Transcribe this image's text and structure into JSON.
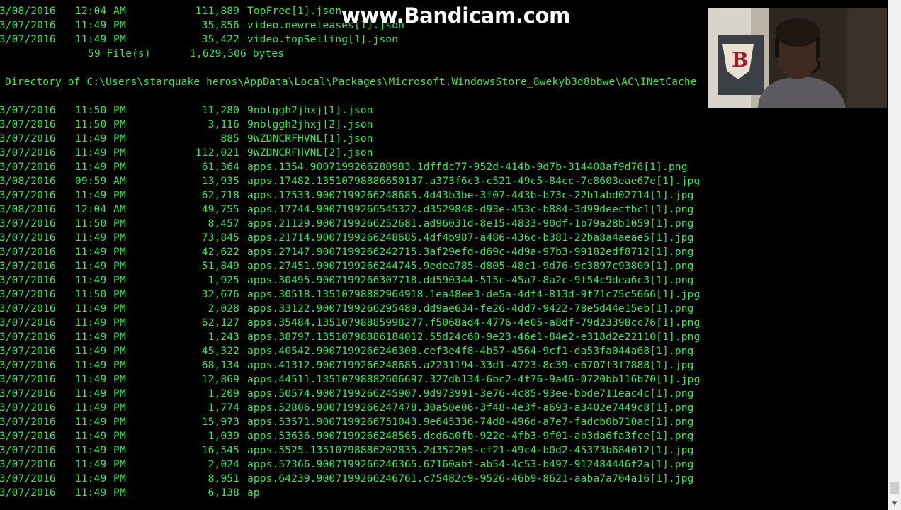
{
  "console": {
    "top_entries": [
      {
        "date": "03/08/2016",
        "time": "12:04",
        "ampm": "AM",
        "size": "111,889",
        "name": "TopFree[1].json"
      },
      {
        "date": "03/07/2016",
        "time": "11:49",
        "ampm": "PM",
        "size": "35,856",
        "name": "video.newreleases[1].json"
      },
      {
        "date": "03/07/2016",
        "time": "11:49",
        "ampm": "PM",
        "size": "35,422",
        "name": "video.topSelling[1].json"
      }
    ],
    "summary": {
      "count": "59 File(s)",
      "bytes": "1,629,506 bytes"
    },
    "directory_line": "Directory of C:\\Users\\starquake heros\\AppData\\Local\\Packages\\Microsoft.WindowsStore_8wekyb3d8bbwe\\AC\\INetCache",
    "entries": [
      {
        "date": "03/07/2016",
        "time": "11:50",
        "ampm": "PM",
        "size": "11,280",
        "name": "9nblggh2jhxj[1].json"
      },
      {
        "date": "03/07/2016",
        "time": "11:50",
        "ampm": "PM",
        "size": "3,116",
        "name": "9nblggh2jhxj[2].json"
      },
      {
        "date": "03/07/2016",
        "time": "11:49",
        "ampm": "PM",
        "size": "885",
        "name": "9WZDNCRFHVNL[1].json"
      },
      {
        "date": "03/07/2016",
        "time": "11:49",
        "ampm": "PM",
        "size": "112,021",
        "name": "9WZDNCRFHVNL[2].json"
      },
      {
        "date": "03/07/2016",
        "time": "11:49",
        "ampm": "PM",
        "size": "61,364",
        "name": "apps.1354.9007199266280983.1dffdc77-952d-414b-9d7b-314408af9d76[1].png"
      },
      {
        "date": "03/08/2016",
        "time": "09:59",
        "ampm": "AM",
        "size": "13,935",
        "name": "apps.17482.13510798886650137.a373f6c3-c521-49c5-84cc-7c8603eae67e[1].jpg"
      },
      {
        "date": "03/07/2016",
        "time": "11:49",
        "ampm": "PM",
        "size": "62,718",
        "name": "apps.17533.9007199266248685.4d43b3be-3f07-443b-b73c-22b1abd02714[1].jpg"
      },
      {
        "date": "03/08/2016",
        "time": "12:04",
        "ampm": "AM",
        "size": "49,755",
        "name": "apps.17744.9007199266545322.d3529848-d93e-453c-b884-3d99deecfbc1[1].png"
      },
      {
        "date": "03/07/2016",
        "time": "11:50",
        "ampm": "PM",
        "size": "8,457",
        "name": "apps.21129.9007199266252681.ad96031d-8e15-4833-90df-1b79a28b1059[1].png"
      },
      {
        "date": "03/07/2016",
        "time": "11:49",
        "ampm": "PM",
        "size": "73,845",
        "name": "apps.21714.9007199266248685.4df4b987-a486-436c-b381-22ba8a4aeae5[1].jpg"
      },
      {
        "date": "03/07/2016",
        "time": "11:49",
        "ampm": "PM",
        "size": "42,622",
        "name": "apps.27147.9007199266242715.3af29efd-d69c-4d9a-97b3-99182edf8712[1].png"
      },
      {
        "date": "03/07/2016",
        "time": "11:49",
        "ampm": "PM",
        "size": "51,849",
        "name": "apps.27451.9007199266244745.9edea785-d805-48c1-9d76-9c3897c93809[1].png"
      },
      {
        "date": "03/07/2016",
        "time": "11:49",
        "ampm": "PM",
        "size": "1,925",
        "name": "apps.30495.9007199266307718.dd590344-515c-45a7-8a2c-9f54c9dea6c3[1].png"
      },
      {
        "date": "03/07/2016",
        "time": "11:50",
        "ampm": "PM",
        "size": "32,676",
        "name": "apps.30518.13510798882964918.1ea48ee3-de5a-4df4-813d-9f71c75c5666[1].jpg"
      },
      {
        "date": "03/07/2016",
        "time": "11:49",
        "ampm": "PM",
        "size": "2,028",
        "name": "apps.33122.9007199266295489.dd9ae634-fe26-4dd7-9422-78e5d44e15eb[1].png"
      },
      {
        "date": "03/07/2016",
        "time": "11:49",
        "ampm": "PM",
        "size": "62,127",
        "name": "apps.35484.13510798885998277.f5068ad4-4776-4e05-a8df-79d23398cc76[1].png"
      },
      {
        "date": "03/07/2016",
        "time": "11:49",
        "ampm": "PM",
        "size": "1,243",
        "name": "apps.38797.13510798886184012.55d24c60-9e23-46e1-84e2-e318d2e22110[1].png"
      },
      {
        "date": "03/07/2016",
        "time": "11:49",
        "ampm": "PM",
        "size": "45,322",
        "name": "apps.40542.9007199266246308.cef3e4f8-4b57-4564-9cf1-da53fa044a68[1].png"
      },
      {
        "date": "03/07/2016",
        "time": "11:49",
        "ampm": "PM",
        "size": "68,134",
        "name": "apps.41312.9007199266248685.a2231194-33d1-4723-8c39-e6707f3f7888[1].jpg"
      },
      {
        "date": "03/07/2016",
        "time": "11:49",
        "ampm": "PM",
        "size": "12,869",
        "name": "apps.44511.13510798882606697.327db134-6bc2-4f76-9a46-0720bb116b70[1].jpg"
      },
      {
        "date": "03/07/2016",
        "time": "11:49",
        "ampm": "PM",
        "size": "1,209",
        "name": "apps.50574.9007199266245907.9d973991-3e76-4c85-93ee-bbde711eac4c[1].png"
      },
      {
        "date": "03/07/2016",
        "time": "11:49",
        "ampm": "PM",
        "size": "1,774",
        "name": "apps.52806.9007199266247478.30a50e06-3f48-4e3f-a693-a3402e7449c8[1].png"
      },
      {
        "date": "03/07/2016",
        "time": "11:49",
        "ampm": "PM",
        "size": "15,973",
        "name": "apps.53571.9007199266751043.9e645336-74d8-496d-a7e7-fadcb0b710ac[1].png"
      },
      {
        "date": "03/07/2016",
        "time": "11:49",
        "ampm": "PM",
        "size": "1,039",
        "name": "apps.53636.9007199266248565.dcd6a0fb-922e-4fb3-9f01-ab3da6fa3fce[1].png"
      },
      {
        "date": "03/07/2016",
        "time": "11:49",
        "ampm": "PM",
        "size": "16,545",
        "name": "apps.5525.13510798886202835.2d352205-cf21-49c4-b0d2-45373b684012[1].jpg"
      },
      {
        "date": "03/07/2016",
        "time": "11:49",
        "ampm": "PM",
        "size": "2,024",
        "name": "apps.57366.9007199266246365.67160abf-ab54-4c53-b497-912484446f2a[1].png"
      },
      {
        "date": "03/07/2016",
        "time": "11:49",
        "ampm": "PM",
        "size": "8,951",
        "name": "apps.64239.9007199266246761.c75482c9-9526-46b9-8621-aaba7a704a16[1].jpg"
      },
      {
        "date": "03/07/2016",
        "time": "11:49",
        "ampm": "PM",
        "size": "6,138",
        "name": "ap"
      }
    ]
  },
  "watermark": {
    "text": "www.Bandicam.com"
  },
  "colors": {
    "text": "#3ce65a",
    "background": "#000000"
  },
  "icons": {
    "scroll_down": "arrow-down-icon"
  }
}
